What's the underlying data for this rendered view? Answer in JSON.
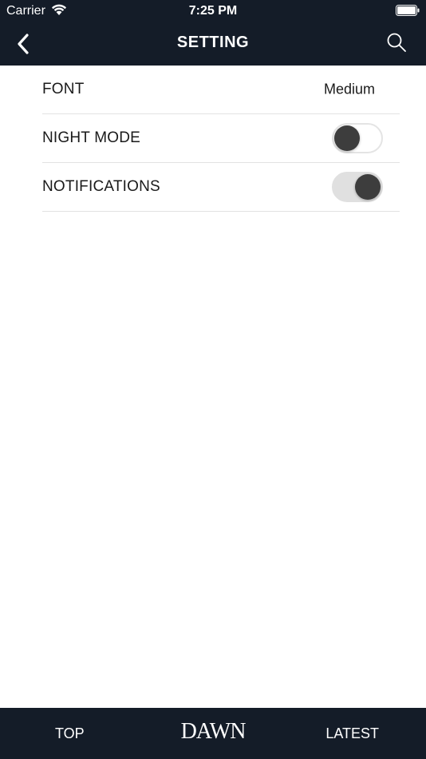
{
  "status_bar": {
    "carrier": "Carrier",
    "time": "7:25 PM",
    "wifi_icon": "wifi-icon",
    "battery_icon": "battery-icon"
  },
  "nav": {
    "title": "SETTING",
    "back_icon": "chevron-left-icon",
    "search_icon": "search-icon"
  },
  "settings": {
    "font_label": "FONT",
    "font_value": "Medium",
    "night_mode_label": "NIGHT MODE",
    "night_mode_enabled": false,
    "notifications_label": "NOTIFICATIONS",
    "notifications_enabled": true
  },
  "tab_bar": {
    "top_label": "TOP",
    "logo_text": "DAWN",
    "latest_label": "LATEST"
  },
  "colors": {
    "bar_background": "#141c28",
    "toggle_knob": "#3d3d3d",
    "toggle_on_track": "#e0e0e0",
    "divider": "#e2e2e2"
  }
}
